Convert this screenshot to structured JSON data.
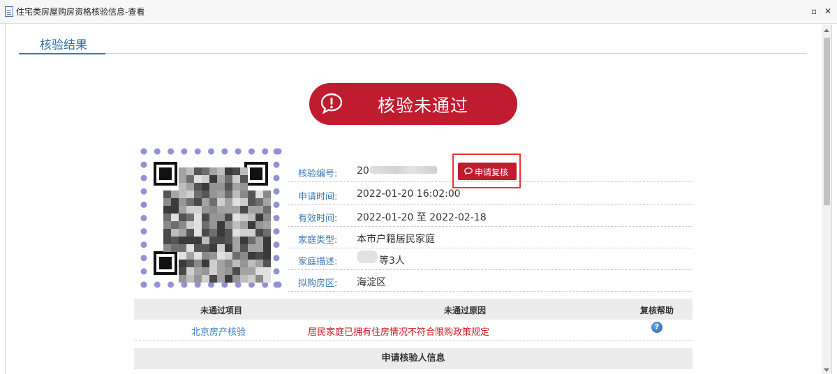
{
  "window": {
    "title": "住宅类房屋购房资格核验信息-查看",
    "maximize_symbol": "▫",
    "close_symbol": "✕"
  },
  "section": {
    "tab_label": "核验结果"
  },
  "result_banner": {
    "text": "核验未通过",
    "icon": "alert-speech-icon",
    "color": "#c01c30"
  },
  "info": {
    "rows": [
      {
        "key": "核验编号:",
        "value": "20"
      },
      {
        "key": "申请时间:",
        "value": "2022-01-20 16:02:00"
      },
      {
        "key": "有效时间:",
        "value": "2022-01-20 至 2022-02-18"
      },
      {
        "key": "家庭类型:",
        "value": "本市户籍居民家庭"
      },
      {
        "key": "家庭描述:",
        "value": "等3人"
      },
      {
        "key": "拟购房区:",
        "value": "海淀区"
      }
    ],
    "review_button": {
      "label": "申请复核",
      "icon": "chat-icon"
    }
  },
  "fail_table": {
    "headers": [
      "未通过项目",
      "未通过原因",
      "复核帮助"
    ],
    "rows": [
      {
        "item": "北京房产核验",
        "reason": "居民家庭已拥有住房情况不符合限购政策规定",
        "help": "?"
      }
    ]
  },
  "applicant_section": {
    "title": "申请核验人信息"
  },
  "colors": {
    "accent_blue": "#3c7ab3",
    "danger_red": "#c01c30",
    "reason_red": "#d0121b"
  }
}
